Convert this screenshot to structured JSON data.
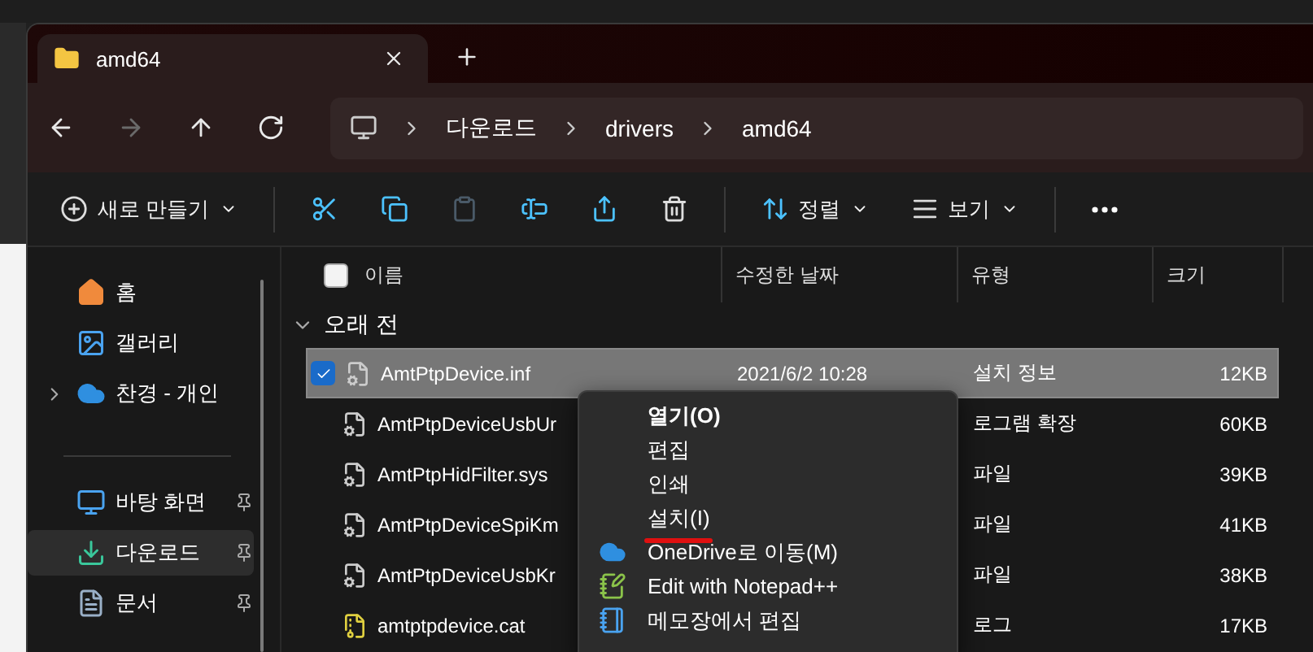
{
  "tab": {
    "title": "amd64"
  },
  "nav_buttons": [
    {
      "kind": "back",
      "disabled": false
    },
    {
      "kind": "forward",
      "disabled": true
    },
    {
      "kind": "up",
      "disabled": false
    },
    {
      "kind": "refresh",
      "disabled": false
    }
  ],
  "breadcrumb": [
    "다운로드",
    "drivers",
    "amd64"
  ],
  "toolbar": [
    {
      "kind": "new",
      "label": "새로 만들기",
      "disabled": false
    },
    {
      "kind": "cut",
      "disabled": false
    },
    {
      "kind": "copy",
      "disabled": false
    },
    {
      "kind": "paste",
      "disabled": true
    },
    {
      "kind": "rename",
      "disabled": false
    },
    {
      "kind": "share",
      "disabled": false
    },
    {
      "kind": "delete",
      "disabled": false
    },
    {
      "kind": "sort",
      "label": "정렬",
      "disabled": false
    },
    {
      "kind": "view",
      "label": "보기",
      "disabled": false
    },
    {
      "kind": "more",
      "disabled": false
    }
  ],
  "sidebar": {
    "groups": [
      {
        "items": [
          {
            "kind": "home",
            "label": "홈",
            "selected": false,
            "pinned": false,
            "expandable": false
          },
          {
            "kind": "gallery",
            "label": "갤러리",
            "selected": false,
            "pinned": false,
            "expandable": false
          },
          {
            "kind": "cloud",
            "label": "찬경 - 개인",
            "selected": false,
            "pinned": false,
            "expandable": true
          }
        ]
      },
      {
        "items": [
          {
            "kind": "desktop",
            "label": "바탕 화면",
            "selected": false,
            "pinned": true,
            "expandable": false
          },
          {
            "kind": "download",
            "label": "다운로드",
            "selected": true,
            "pinned": true,
            "expandable": false
          },
          {
            "kind": "documents",
            "label": "문서",
            "selected": false,
            "pinned": true,
            "expandable": false
          }
        ]
      }
    ]
  },
  "table": {
    "select_all": false,
    "columns": [
      "이름",
      "수정한 날짜",
      "유형",
      "크기"
    ],
    "group": {
      "label": "오래 전",
      "expanded": true
    },
    "rows": [
      {
        "kind": "inf",
        "name": "AmtPtpDevice.inf",
        "date": "2021/6/2 10:28",
        "type": "설치 정보",
        "size": "12KB",
        "selected": true,
        "checked": true
      },
      {
        "kind": "sys",
        "name": "AmtPtpDeviceUsbUr",
        "type": "로그램 확장",
        "size": "60KB",
        "selected": false,
        "checked": false
      },
      {
        "kind": "sys",
        "name": "AmtPtpHidFilter.sys",
        "type": "파일",
        "size": "39KB",
        "selected": false,
        "checked": false
      },
      {
        "kind": "sys",
        "name": "AmtPtpDeviceSpiKm",
        "type": "파일",
        "size": "41KB",
        "selected": false,
        "checked": false
      },
      {
        "kind": "sys",
        "name": "AmtPtpDeviceUsbKr",
        "type": "파일",
        "size": "38KB",
        "selected": false,
        "checked": false
      },
      {
        "kind": "cat",
        "name": "amtptpdevice.cat",
        "type": "로그",
        "size": "17KB",
        "selected": false,
        "checked": false
      }
    ]
  },
  "context_menu": {
    "items": [
      {
        "kind": "plain",
        "label": "열기(O)",
        "bold": true,
        "annotated": false
      },
      {
        "kind": "plain",
        "label": "편집",
        "bold": false,
        "annotated": false
      },
      {
        "kind": "plain",
        "label": "인쇄",
        "bold": false,
        "annotated": false
      },
      {
        "kind": "plain",
        "label": "설치(I)",
        "bold": false,
        "annotated": true
      },
      {
        "kind": "onedrive",
        "label": "OneDrive로 이동(M)",
        "bold": false,
        "annotated": false
      },
      {
        "kind": "notepadpp",
        "label": "Edit with Notepad++",
        "bold": false,
        "annotated": false
      },
      {
        "kind": "notepad",
        "label": "메모장에서 편집",
        "bold": false,
        "annotated": false
      }
    ]
  }
}
